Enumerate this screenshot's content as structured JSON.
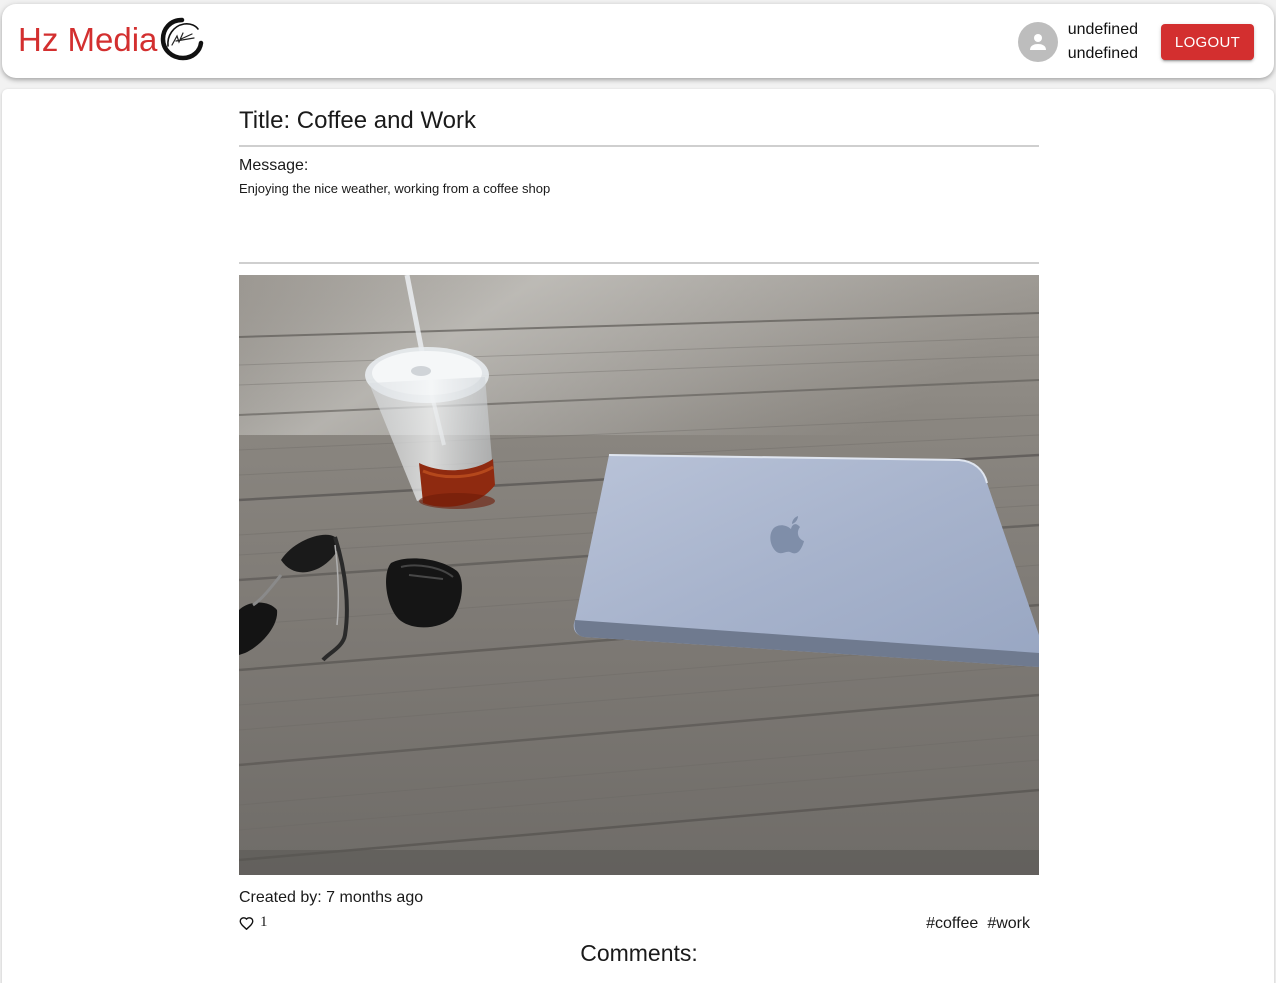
{
  "header": {
    "brand_text": "Hz Media",
    "brand_logo_icon": "brush-circle-logo",
    "user": {
      "first_name": "undefined",
      "last_name": "undefined",
      "avatar_icon": "person-icon"
    },
    "logout_label": "Logout"
  },
  "post": {
    "title": "Title: Coffee and Work",
    "message_label": "Message:",
    "message_text": "Enjoying the nice weather, working from a coffee shop",
    "image_alt": "",
    "created_by": "Created by: 7 months ago",
    "like_icon": "heart-outline-icon",
    "like_count": "1",
    "tags": [
      "#coffee",
      "#work"
    ],
    "comments_heading": "Comments:"
  },
  "colors": {
    "brand_red": "#d32f2f",
    "logout_bg": "#d32f2f",
    "avatar_bg": "#bdbdbd",
    "divider": "#cfcfcf"
  }
}
